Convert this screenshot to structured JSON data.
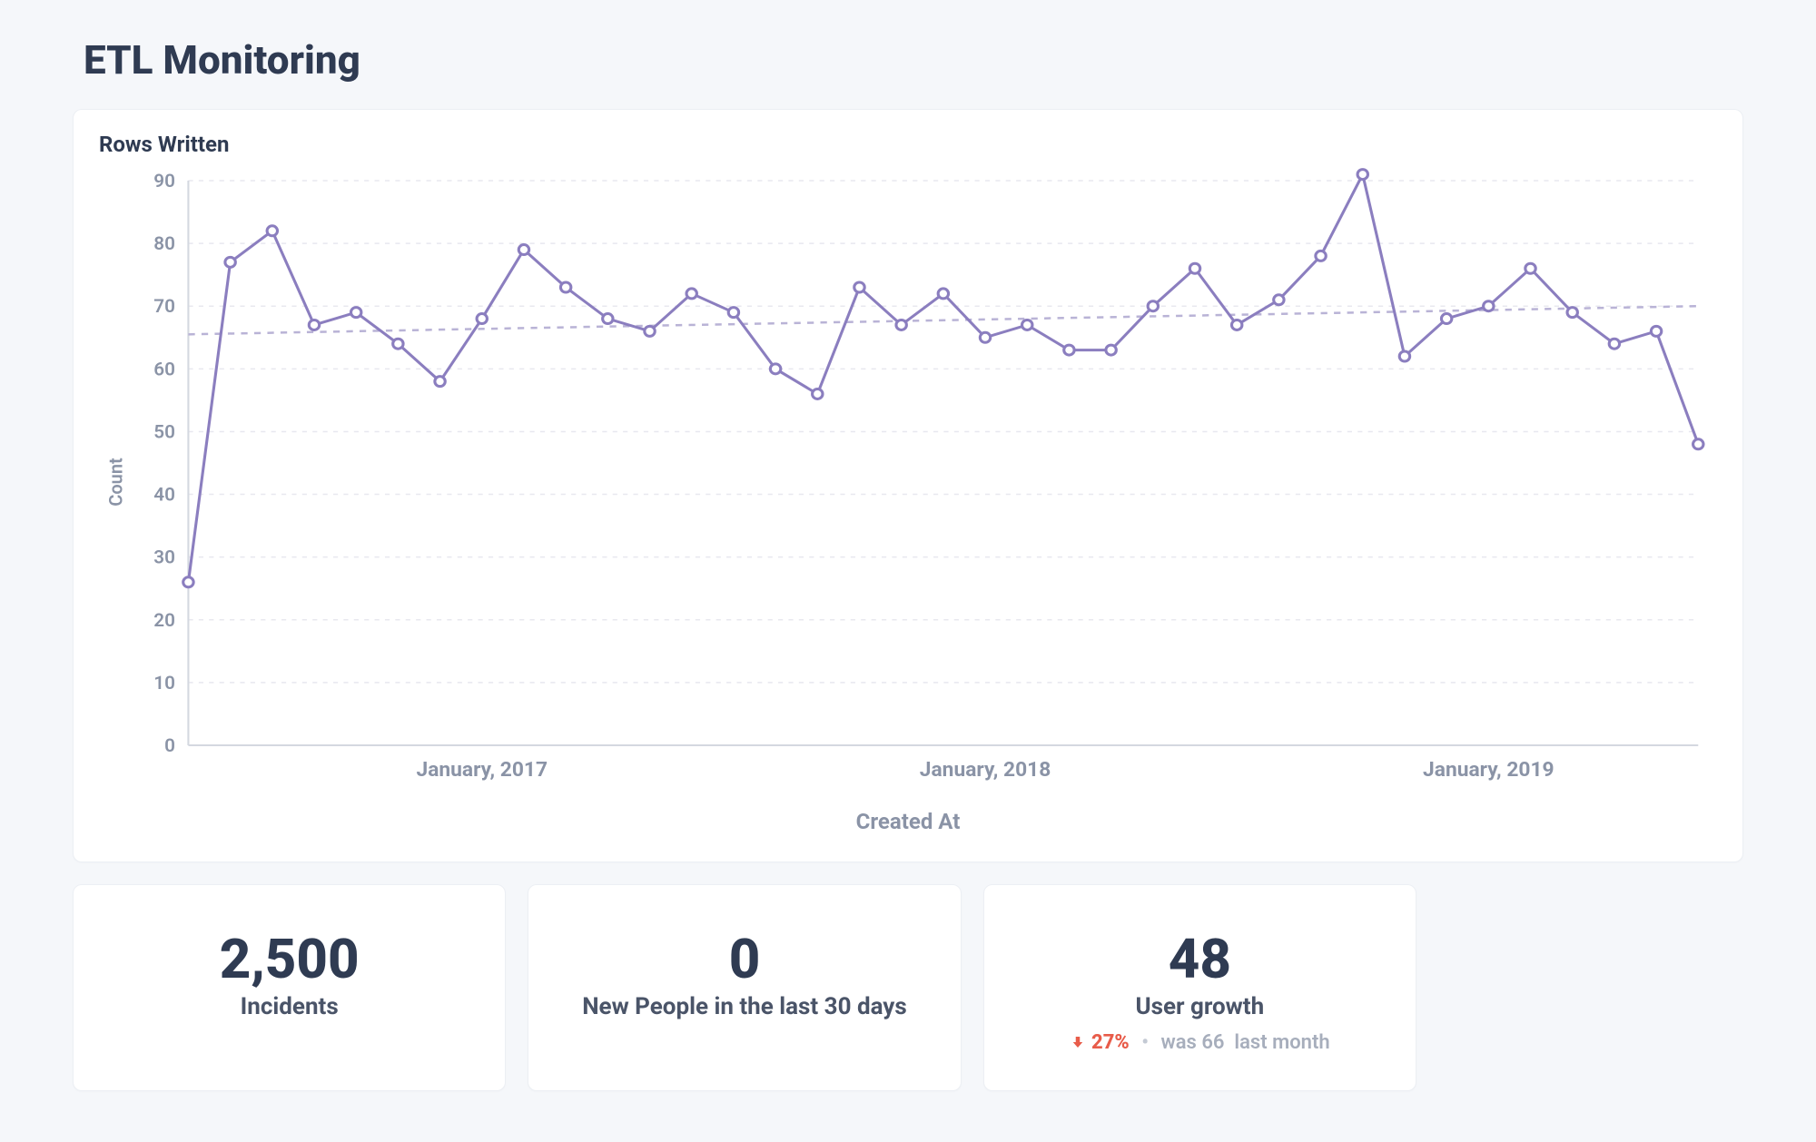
{
  "page": {
    "title": "ETL Monitoring"
  },
  "chart": {
    "title": "Rows Written",
    "ylabel": "Count",
    "xlabel": "Created At"
  },
  "chart_data": {
    "type": "line",
    "title": "Rows Written",
    "xlabel": "Created At",
    "ylabel": "Count",
    "ylim": [
      0,
      90
    ],
    "y_ticks": [
      0,
      10,
      20,
      30,
      40,
      50,
      60,
      70,
      80,
      90
    ],
    "x_tick_labels": [
      "January, 2017",
      "January, 2018",
      "January, 2019"
    ],
    "x_tick_indices": [
      7,
      19,
      31
    ],
    "values": [
      26,
      77,
      82,
      67,
      69,
      64,
      58,
      68,
      79,
      73,
      68,
      66,
      72,
      69,
      60,
      56,
      73,
      67,
      72,
      65,
      67,
      63,
      63,
      70,
      76,
      67,
      71,
      78,
      91,
      62,
      68,
      70,
      76,
      69,
      64,
      66,
      48
    ],
    "trend": {
      "start_y": 65.5,
      "end_y": 70
    },
    "series_color": "#8b7ebf"
  },
  "metrics": [
    {
      "value": "2,500",
      "label": "Incidents"
    },
    {
      "value": "0",
      "label": "New People in the last 30 days"
    },
    {
      "value": "48",
      "label": "User growth",
      "delta": {
        "direction": "down",
        "percent": "27%",
        "note_prefix": "was",
        "note_value": "66",
        "note_suffix": "last month"
      }
    }
  ]
}
